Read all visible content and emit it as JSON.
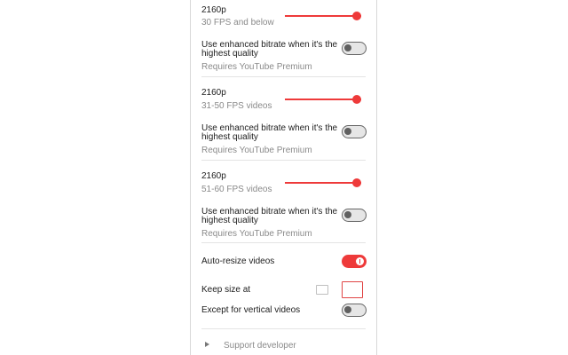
{
  "sections": [
    {
      "quality": "2160p",
      "fps_label": "30 FPS and below",
      "slider_value_fraction": 0.95,
      "enhanced_label_line1": "Use enhanced bitrate when it's the",
      "enhanced_label_line2": "highest quality",
      "enhanced_enabled": false,
      "requires": "Requires YouTube Premium"
    },
    {
      "quality": "2160p",
      "fps_label": "31-50 FPS videos",
      "slider_value_fraction": 0.95,
      "enhanced_label_line1": "Use enhanced bitrate when it's the",
      "enhanced_label_line2": "highest quality",
      "enhanced_enabled": false,
      "requires": "Requires YouTube Premium"
    },
    {
      "quality": "2160p",
      "fps_label": "51-60 FPS videos",
      "slider_value_fraction": 0.95,
      "enhanced_label_line1": "Use enhanced bitrate when it's the",
      "enhanced_label_line2": "highest quality",
      "enhanced_enabled": false,
      "requires": "Requires YouTube Premium"
    }
  ],
  "auto_resize": {
    "label": "Auto-resize videos",
    "enabled": true
  },
  "keep_size": {
    "label": "Keep size at"
  },
  "except_vertical": {
    "label": "Except for vertical videos",
    "enabled": false
  },
  "support": {
    "label": "Support developer"
  },
  "colors": {
    "accent": "#ee3a3a",
    "muted_text": "#8a8a8a",
    "divider": "#e4e4e4"
  }
}
